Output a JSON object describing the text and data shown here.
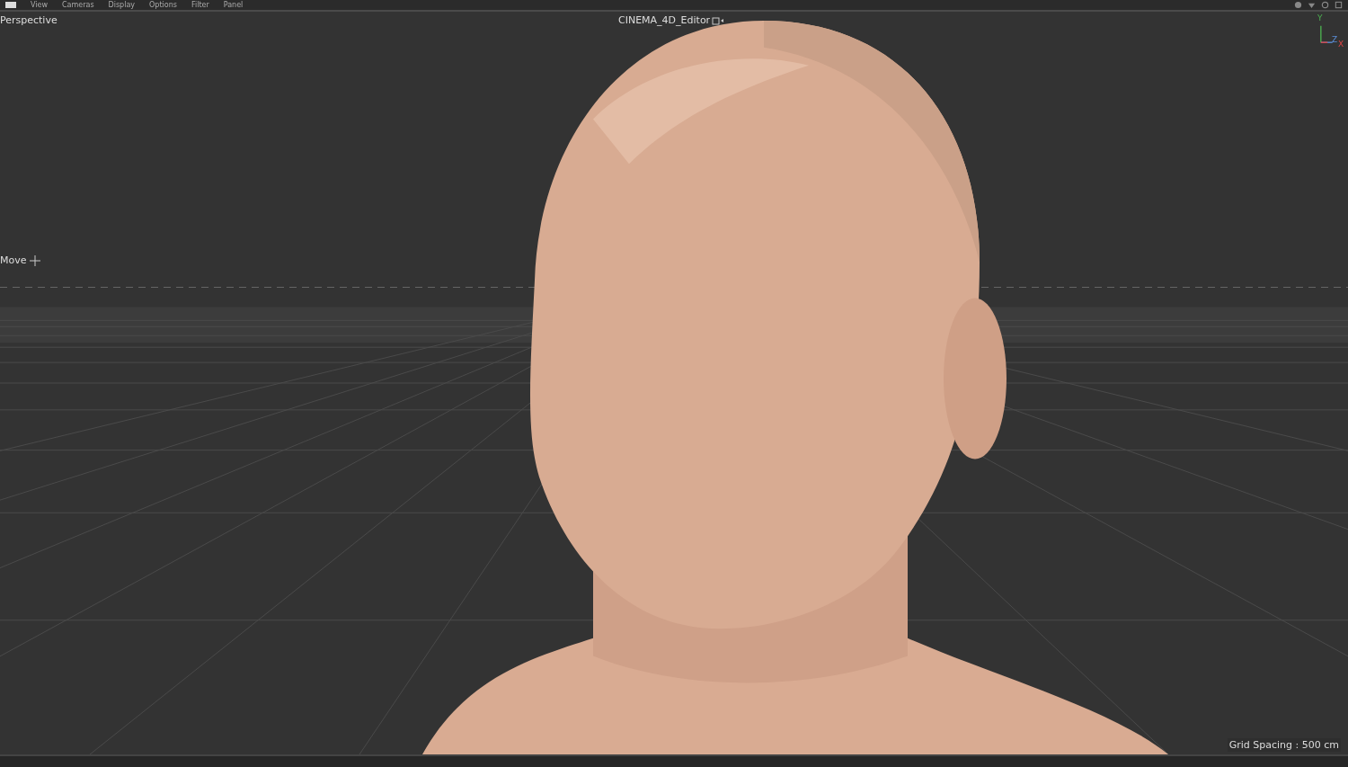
{
  "menu_bar": {
    "items": [
      "View",
      "Cameras",
      "Display",
      "Options",
      "Filter",
      "Panel"
    ]
  },
  "viewport": {
    "camera_label": "Perspective",
    "title": "CINEMA_4D_Editor",
    "tool_label": "Move",
    "axes": [
      "Y",
      "Z",
      "X"
    ],
    "grid_spacing": "Grid Spacing : 500 cm"
  }
}
